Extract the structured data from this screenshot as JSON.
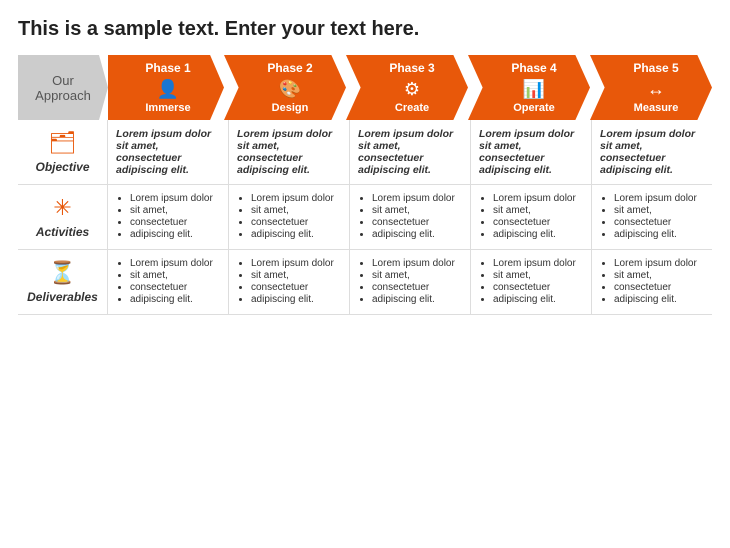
{
  "title": "This is a sample text. Enter your text here.",
  "approach_label": "Our\nApproach",
  "phases": [
    {
      "num": "Phase 1",
      "icon": "👤",
      "name": "Immerse"
    },
    {
      "num": "Phase 2",
      "icon": "🎨",
      "name": "Design"
    },
    {
      "num": "Phase 3",
      "icon": "⚙",
      "name": "Create"
    },
    {
      "num": "Phase 4",
      "icon": "📊",
      "name": "Operate"
    },
    {
      "num": "Phase 5",
      "icon": "↔",
      "name": "Measure"
    }
  ],
  "rows": [
    {
      "label": "Objective",
      "icon": "🗂",
      "icon_type": "objective",
      "cells": [
        "Lorem ipsum dolor sit amet, consectetuer adipiscing elit.",
        "Lorem ipsum dolor sit amet, consectetuer adipiscing elit.",
        "Lorem ipsum dolor sit amet, consectetuer adipiscing elit.",
        "Lorem ipsum dolor sit amet, consectetuer adipiscing elit.",
        "Lorem ipsum dolor sit amet, consectetuer adipiscing elit."
      ],
      "type": "text"
    },
    {
      "label": "Activities",
      "icon": "✳",
      "icon_type": "activities",
      "cells": [
        [
          "Lorem ipsum dolor",
          "sit amet,",
          "consectetuer",
          "adipiscing elit."
        ],
        [
          "Lorem ipsum dolor",
          "sit amet,",
          "consectetuer",
          "adipiscing elit."
        ],
        [
          "Lorem ipsum dolor",
          "sit amet,",
          "consectetuer",
          "adipiscing elit."
        ],
        [
          "Lorem ipsum dolor",
          "sit amet,",
          "consectetuer",
          "adipiscing elit."
        ],
        [
          "Lorem ipsum dolor",
          "sit amet,",
          "consectetuer",
          "adipiscing elit."
        ]
      ],
      "type": "list"
    },
    {
      "label": "Deliverables",
      "icon": "⏳",
      "icon_type": "deliverables",
      "cells": [
        [
          "Lorem ipsum dolor",
          "sit amet,",
          "consectetuer",
          "adipiscing elit."
        ],
        [
          "Lorem ipsum dolor",
          "sit amet,",
          "consectetuer",
          "adipiscing elit."
        ],
        [
          "Lorem ipsum dolor",
          "sit amet,",
          "consectetuer",
          "adipiscing elit."
        ],
        [
          "Lorem ipsum dolor",
          "sit amet,",
          "consectetuer",
          "adipiscing elit."
        ],
        [
          "Lorem ipsum dolor",
          "sit amet,",
          "consectetuer",
          "adipiscing elit."
        ]
      ],
      "type": "list"
    }
  ],
  "colors": {
    "accent": "#e8580a",
    "gray": "#ccc",
    "border": "#ddd"
  }
}
